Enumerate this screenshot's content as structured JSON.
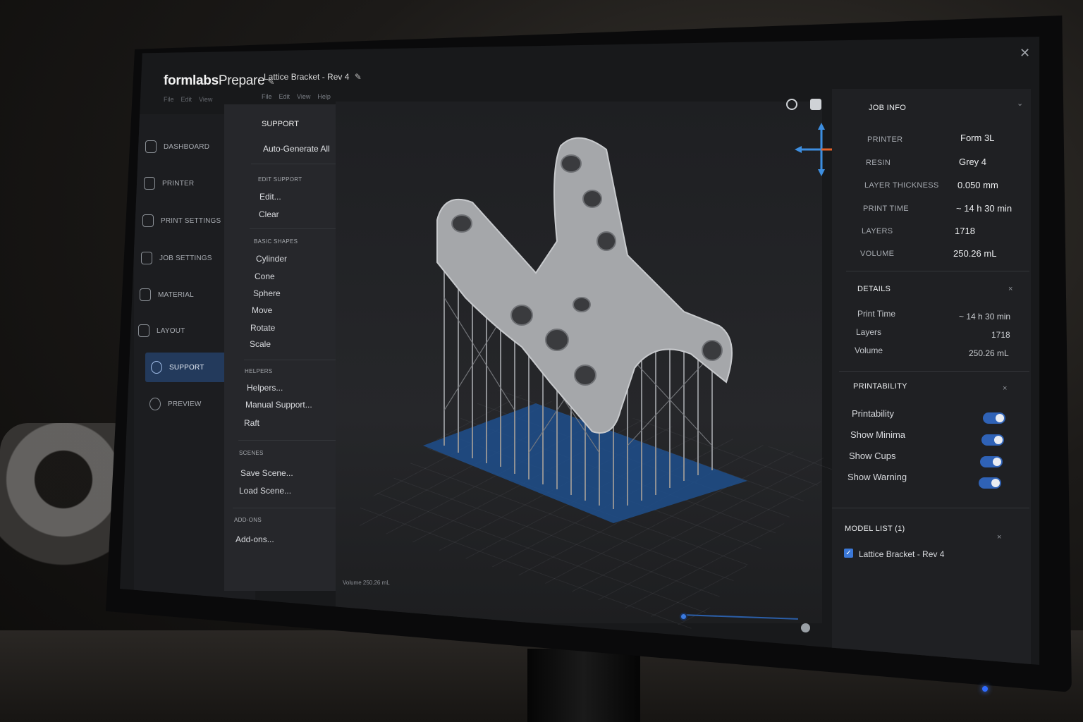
{
  "app": {
    "brand_bold": "formlabs",
    "brand_rest": "Prepare",
    "document_title": "Lattice Bracket - Rev 4",
    "menu_top": [
      "File",
      "Edit",
      "View"
    ],
    "menu_secondary": [
      "File",
      "Edit",
      "View",
      "Help"
    ],
    "close_symbol": "✕"
  },
  "sidebar": {
    "items": [
      {
        "label": "DASHBOARD",
        "icon": "dashboard-icon"
      },
      {
        "label": "PRINTER",
        "icon": "printer-icon"
      },
      {
        "label": "PRINT SETTINGS",
        "icon": "print-settings-icon"
      },
      {
        "label": "JOB SETTINGS",
        "icon": "job-settings-icon"
      },
      {
        "label": "MATERIAL",
        "icon": "material-icon"
      },
      {
        "label": "LAYOUT",
        "icon": "layout-icon"
      },
      {
        "label": "SUPPORT",
        "icon": "support-icon",
        "active": true
      },
      {
        "label": "PREVIEW",
        "icon": "preview-icon"
      }
    ]
  },
  "support_panel": {
    "title": "SUPPORT",
    "close": "×",
    "auto_generate": "Auto-Generate All",
    "sections": [
      {
        "title": "EDIT SUPPORT",
        "items": [
          "Edit...",
          "Clear"
        ]
      },
      {
        "title": "BASIC SHAPES",
        "items": [
          "Cylinder",
          "Cone",
          "Sphere",
          "Move",
          "Rotate",
          "Scale"
        ]
      },
      {
        "title": "HELPERS",
        "items": [
          "Helpers...",
          "Manual Support...",
          "Raft"
        ]
      },
      {
        "title": "SCENES",
        "items": [
          "Save Scene...",
          "Load Scene..."
        ]
      },
      {
        "title": "ADD-ONS",
        "items": [
          "Add-ons..."
        ]
      }
    ]
  },
  "viewport": {
    "status": "Volume 250.26 mL",
    "view_icons": [
      "rotate-view-icon",
      "cube-view-icon",
      "reset-view-icon"
    ],
    "axis_colors": {
      "x": "#e5622a",
      "y": "#3d8ee0",
      "z": "#3d8ee0"
    },
    "model_color": "#a5a7aa",
    "raft_color": "#1e4f8c"
  },
  "job_info": {
    "title": "JOB INFO",
    "rows": [
      {
        "label": "PRINTER",
        "value": "Form 3L"
      },
      {
        "label": "RESIN",
        "value": "Grey 4"
      },
      {
        "label": "LAYER THICKNESS",
        "value": "0.050 mm"
      },
      {
        "label": "PRINT TIME",
        "value": "~ 14 h 30 min"
      },
      {
        "label": "LAYERS",
        "value": "1718"
      },
      {
        "label": "VOLUME",
        "value": "250.26 mL"
      }
    ]
  },
  "details": {
    "title": "DETAILS",
    "close": "×",
    "rows": [
      {
        "label": "Print Time",
        "value": "~ 14 h 30 min"
      },
      {
        "label": "Layers",
        "value": "1718"
      },
      {
        "label": "Volume",
        "value": "250.26 mL"
      }
    ]
  },
  "printability": {
    "title": "PRINTABILITY",
    "close": "×",
    "toggles": [
      {
        "label": "Printability",
        "on": true
      },
      {
        "label": "Show Minima",
        "on": true
      },
      {
        "label": "Show Cups",
        "on": true
      },
      {
        "label": "Show Warning",
        "on": true
      }
    ]
  },
  "model_list": {
    "title": "MODEL LIST (1)",
    "close": "×",
    "models": [
      {
        "name": "Lattice Bracket - Rev 4",
        "checked": true
      }
    ]
  }
}
